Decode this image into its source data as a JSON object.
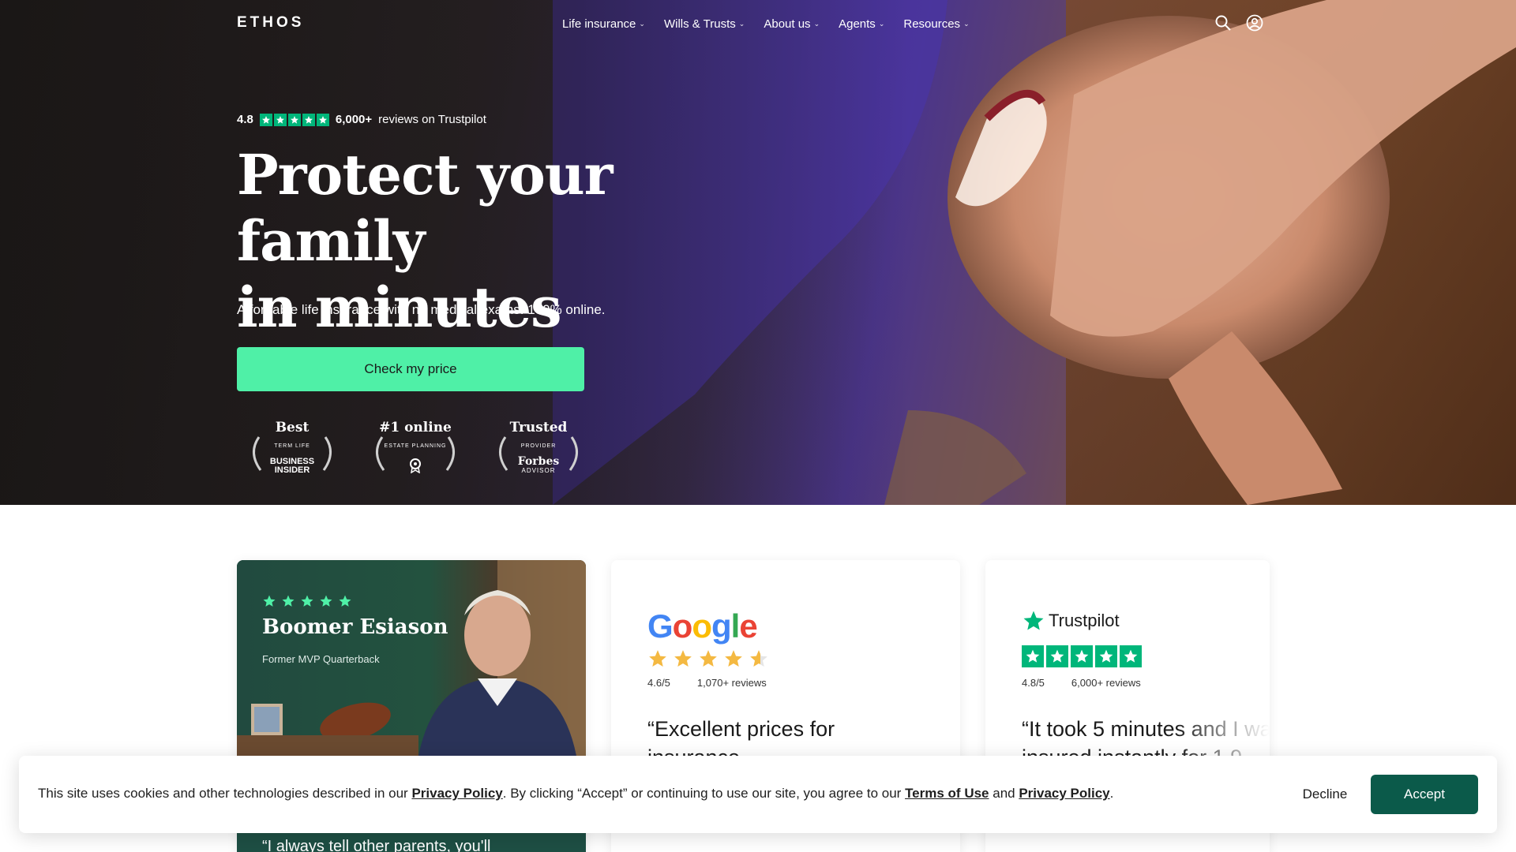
{
  "nav": {
    "logo": "ETHOS",
    "items": [
      {
        "label": "Life insurance"
      },
      {
        "label": "Wills & Trusts"
      },
      {
        "label": "About us"
      },
      {
        "label": "Agents"
      },
      {
        "label": "Resources"
      }
    ],
    "icons": [
      "search-icon",
      "account-icon"
    ]
  },
  "hero": {
    "rating_score": "4.8",
    "rating_count": "6,000+",
    "rating_suffix": "reviews on Trustpilot",
    "headline_line1": "Protect your family",
    "headline_line2": "in minutes",
    "subhead": "Affordable life insurance with no medical exams. 100% online.",
    "cta_label": "Check my price",
    "awards": [
      {
        "big": "Best",
        "small": "TERM LIFE",
        "brand_line1": "BUSINESS",
        "brand_line2": "INSIDER"
      },
      {
        "big": "#1 online",
        "small": "ESTATE PLANNING",
        "brand_icon": "award-ribbon-icon"
      },
      {
        "big": "Trusted",
        "small": "PROVIDER",
        "brand_line1": "Forbes",
        "brand_line2": "ADVISOR"
      }
    ]
  },
  "cards": {
    "video": {
      "name": "Boomer Esiason",
      "role": "Former MVP Quarterback",
      "quote": "“I always tell other parents, you'll"
    },
    "google": {
      "logo": "Google",
      "score": "4.6/5",
      "reviews": "1,070+ reviews",
      "quote": "“Excellent prices for insurance"
    },
    "trustpilot": {
      "logo": "Trustpilot",
      "score": "4.8/5",
      "reviews": "6,000+ reviews",
      "quote": "“It took 5 minutes and I was insured instantly for 1.9"
    }
  },
  "cookie": {
    "text_1": "This site uses cookies and other technologies described in our ",
    "privacy_link": "Privacy Policy",
    "text_2": ". By clicking “Accept” or continuing to use our site, you agree to our ",
    "terms_link": "Terms of Use",
    "text_3": " and ",
    "privacy_link_2": "Privacy Policy",
    "text_4": ".",
    "decline_label": "Decline",
    "accept_label": "Accept"
  },
  "colors": {
    "cta": "#4ff0a7",
    "trustpilot_green": "#00b67a",
    "accept": "#0b5a4a",
    "video_card": "#1e4f44"
  }
}
